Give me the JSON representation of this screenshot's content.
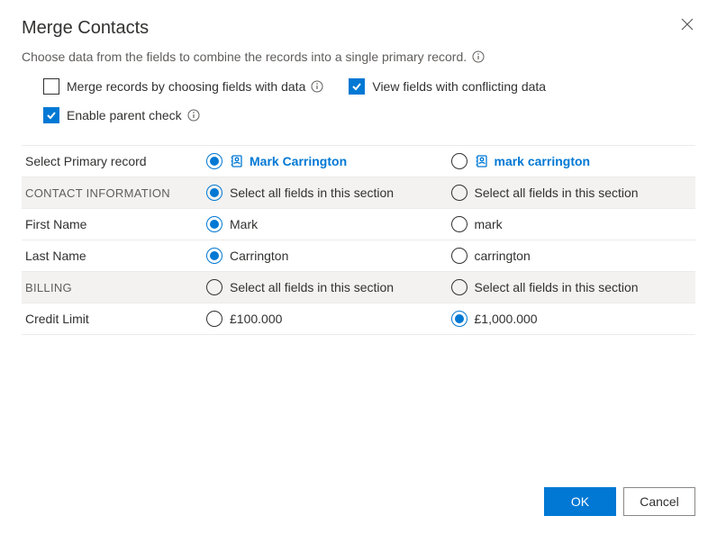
{
  "dialog": {
    "title": "Merge Contacts",
    "subtitle": "Choose data from the fields to combine the records into a single primary record."
  },
  "checkboxes": {
    "merge_by_fields": {
      "label": "Merge records by choosing fields with data",
      "checked": false
    },
    "view_conflicting": {
      "label": "View fields with conflicting data",
      "checked": true
    },
    "enable_parent": {
      "label": "Enable parent check",
      "checked": true
    }
  },
  "grid": {
    "primary_row_label": "Select Primary record",
    "record1_name": "Mark Carrington",
    "record2_name": "mark carrington",
    "select_all_label": "Select all fields in this section",
    "sections": [
      {
        "title": "CONTACT INFORMATION",
        "select_all_col1": true,
        "select_all_col2": false,
        "fields": [
          {
            "label": "First Name",
            "val1": "Mark",
            "val2": "mark",
            "selected": 1
          },
          {
            "label": "Last Name",
            "val1": "Carrington",
            "val2": "carrington",
            "selected": 1
          }
        ]
      },
      {
        "title": "BILLING",
        "select_all_col1": false,
        "select_all_col2": false,
        "fields": [
          {
            "label": "Credit Limit",
            "val1": "£100.000",
            "val2": "£1,000.000",
            "selected": 2
          }
        ]
      }
    ]
  },
  "footer": {
    "ok": "OK",
    "cancel": "Cancel"
  }
}
